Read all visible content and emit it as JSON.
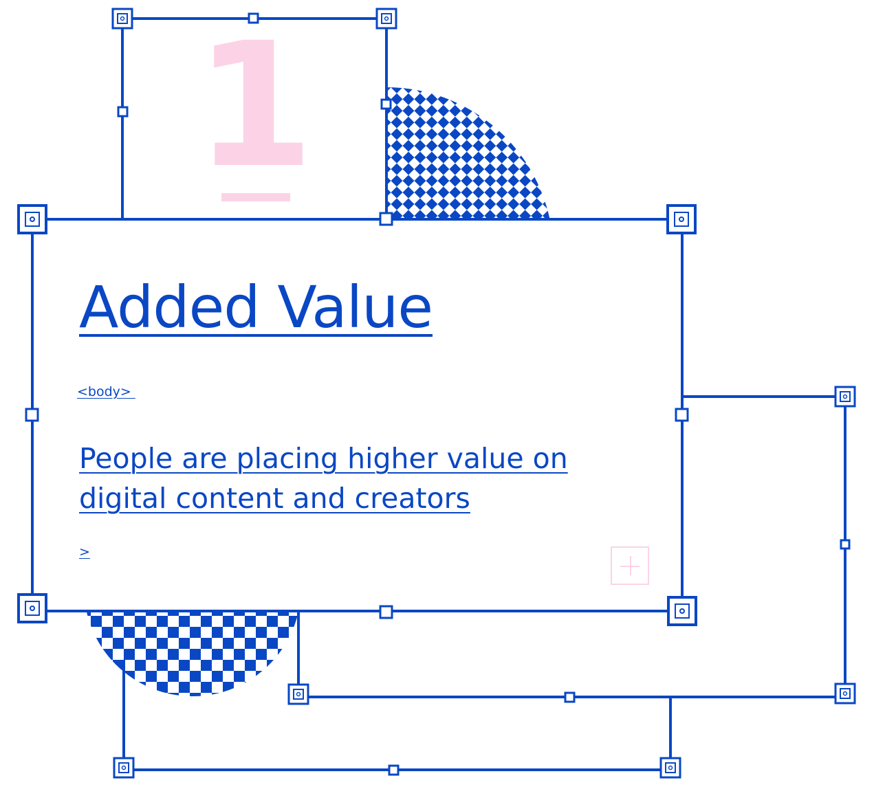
{
  "big_number": "1",
  "card": {
    "headline": "Added Value",
    "open_tag": "<body> ",
    "body": "People are placing higher value on digital content and creators",
    "close_tag": ">"
  },
  "colors": {
    "accent": "#0a47c4",
    "pink": "#fcd3e6",
    "background": "#ffffff"
  },
  "icons": {
    "handle": "square-handle-icon",
    "add": "plus-icon"
  }
}
